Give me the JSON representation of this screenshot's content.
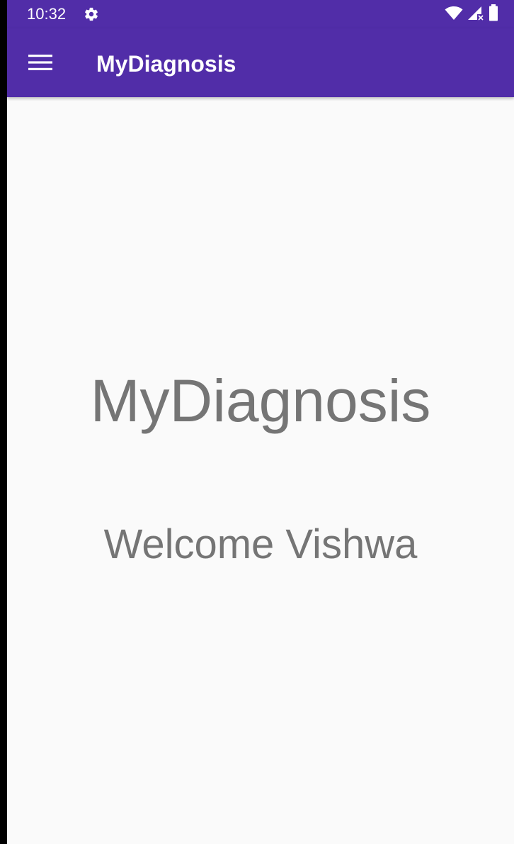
{
  "status_bar": {
    "time": "10:32",
    "icons": [
      "settings-gear-icon",
      "wifi-icon",
      "cell-signal-no-data-icon",
      "battery-icon"
    ]
  },
  "toolbar": {
    "menu_icon": "hamburger-menu-icon",
    "title": "MyDiagnosis"
  },
  "main": {
    "app_name": "MyDiagnosis",
    "welcome_text": "Welcome Vishwa"
  },
  "colors": {
    "primary": "#512da8",
    "background": "#fafafa",
    "text_secondary": "#757575"
  }
}
